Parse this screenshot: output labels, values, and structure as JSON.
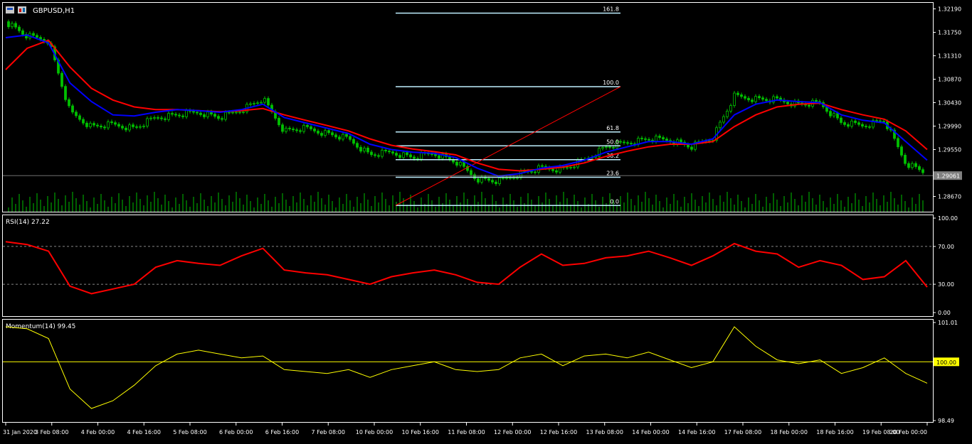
{
  "colors": {
    "background": "#000000",
    "candle": "#00c000",
    "volume": "#00c000",
    "fast_ma": "#0000ff",
    "slow_ma": "#ff0000",
    "fib_line": "#bfefff",
    "trend_line": "#ff0000",
    "rsi": "#ff0000",
    "momentum": "#ffff00",
    "text": "#ffffff",
    "axis": "#ffffff"
  },
  "chart_title": "GBPUSD,H1",
  "current_price_label": "1.29061",
  "chart_data": [
    {
      "type": "line",
      "panel": "price",
      "title": "GBPUSD,H1",
      "ylim": [
        1.2845,
        1.3225
      ],
      "y_ticks": [
        "1.32190",
        "1.31750",
        "1.31310",
        "1.30870",
        "1.30430",
        "1.29990",
        "1.29550",
        "1.29061",
        "1.28670"
      ],
      "x_tick_labels": [
        "31 Jan 2020",
        "3 Feb 08:00",
        "4 Feb 00:00",
        "4 Feb 16:00",
        "5 Feb 08:00",
        "6 Feb 00:00",
        "6 Feb 16:00",
        "7 Feb 08:00",
        "10 Feb 00:00",
        "10 Feb 16:00",
        "11 Feb 08:00",
        "12 Feb 00:00",
        "12 Feb 16:00",
        "13 Feb 08:00",
        "14 Feb 00:00",
        "14 Feb 16:00",
        "17 Feb 08:00",
        "18 Feb 00:00",
        "18 Feb 16:00",
        "19 Feb 08:00",
        "20 Feb 00:00"
      ],
      "x": [
        0,
        8,
        16,
        24,
        32,
        40,
        48,
        56,
        64,
        72,
        80,
        88,
        96,
        104,
        112,
        120,
        128,
        136,
        144,
        152,
        160,
        168,
        176,
        184,
        192,
        200,
        208,
        216,
        224,
        232,
        240,
        248,
        256,
        264,
        272,
        280,
        288,
        296,
        304,
        312,
        320,
        328,
        336,
        344
      ],
      "series": [
        {
          "values": [
            1.3195,
            1.3168,
            1.316,
            1.3025,
            1.2998,
            1.3002,
            1.2995,
            1.3015,
            1.302,
            1.3025,
            1.3015,
            1.303,
            1.305,
            1.299,
            1.2995,
            1.2985,
            1.2975,
            1.2945,
            1.295,
            1.294,
            1.2948,
            1.2932,
            1.29,
            1.2895,
            1.291,
            1.292,
            1.2918,
            1.2935,
            1.296,
            1.2968,
            1.2975,
            1.2973,
            1.296,
            1.2978,
            1.3055,
            1.305,
            1.3048,
            1.304,
            1.3042,
            1.3005,
            1.3,
            1.301,
            1.293,
            1.291
          ]
        },
        {
          "values": [
            1.3165,
            1.317,
            1.3155,
            1.308,
            1.3045,
            1.302,
            1.3018,
            1.3025,
            1.303,
            1.3028,
            1.3025,
            1.303,
            1.304,
            1.3015,
            1.3005,
            1.2995,
            1.2985,
            1.2965,
            1.2955,
            1.295,
            1.2948,
            1.294,
            1.292,
            1.2905,
            1.291,
            1.292,
            1.2925,
            1.2935,
            1.295,
            1.296,
            1.297,
            1.297,
            1.2965,
            1.2975,
            1.302,
            1.304,
            1.3048,
            1.3045,
            1.3043,
            1.302,
            1.301,
            1.3005,
            1.297,
            1.2935
          ]
        },
        {
          "values": [
            1.3105,
            1.3145,
            1.316,
            1.311,
            1.307,
            1.3048,
            1.3035,
            1.303,
            1.303,
            1.3028,
            1.3026,
            1.3028,
            1.3032,
            1.302,
            1.301,
            1.3,
            1.299,
            1.2975,
            1.2963,
            1.2956,
            1.2951,
            1.2945,
            1.293,
            1.2918,
            1.2915,
            1.2918,
            1.2922,
            1.293,
            1.2942,
            1.2952,
            1.296,
            1.2965,
            1.2965,
            1.297,
            1.2998,
            1.302,
            1.3035,
            1.304,
            1.3042,
            1.303,
            1.302,
            1.3012,
            1.299,
            1.2955
          ]
        }
      ],
      "fib_levels": [
        {
          "label": "161.8",
          "value": 1.3211
        },
        {
          "label": "100.0",
          "value": 1.3073
        },
        {
          "label": "61.8",
          "value": 1.2988
        },
        {
          "label": "50.0",
          "value": 1.2962
        },
        {
          "label": "38.2",
          "value": 1.2936
        },
        {
          "label": "23.6",
          "value": 1.2903
        },
        {
          "label": "0.0",
          "value": 1.285
        }
      ],
      "current_price": 1.29061
    },
    {
      "type": "line",
      "panel": "rsi",
      "title": "RSI(14) 27.22",
      "ylim": [
        0,
        100
      ],
      "y_ticks": [
        "100.00",
        "70.00",
        "30.00",
        "0.00"
      ],
      "levels": [
        70,
        30
      ],
      "x": [
        0,
        8,
        16,
        24,
        32,
        40,
        48,
        56,
        64,
        72,
        80,
        88,
        96,
        104,
        112,
        120,
        128,
        136,
        144,
        152,
        160,
        168,
        176,
        184,
        192,
        200,
        208,
        216,
        224,
        232,
        240,
        248,
        256,
        264,
        272,
        280,
        288,
        296,
        304,
        312,
        320,
        328,
        336,
        344
      ],
      "series": [
        {
          "values": [
            75,
            72,
            65,
            28,
            20,
            25,
            30,
            48,
            55,
            52,
            50,
            60,
            68,
            45,
            42,
            40,
            35,
            30,
            38,
            42,
            45,
            40,
            32,
            30,
            48,
            62,
            50,
            52,
            58,
            60,
            65,
            58,
            50,
            60,
            73,
            65,
            62,
            48,
            55,
            50,
            35,
            38,
            55,
            27
          ]
        }
      ]
    },
    {
      "type": "line",
      "panel": "momentum",
      "title": "Momentum(14) 99.45",
      "ylim": [
        98.49,
        101.01
      ],
      "y_ticks": [
        "101.01",
        "100.00",
        "98.49"
      ],
      "levels": [
        100.0
      ],
      "x": [
        0,
        8,
        16,
        24,
        32,
        40,
        48,
        56,
        64,
        72,
        80,
        88,
        96,
        104,
        112,
        120,
        128,
        136,
        144,
        152,
        160,
        168,
        176,
        184,
        192,
        200,
        208,
        216,
        224,
        232,
        240,
        248,
        256,
        264,
        272,
        280,
        288,
        296,
        304,
        312,
        320,
        328,
        336,
        344
      ],
      "series": [
        {
          "values": [
            100.9,
            100.85,
            100.6,
            99.3,
            98.8,
            99.0,
            99.4,
            99.9,
            100.2,
            100.3,
            100.2,
            100.1,
            100.15,
            99.8,
            99.75,
            99.7,
            99.8,
            99.6,
            99.8,
            99.9,
            100.0,
            99.8,
            99.75,
            99.8,
            100.1,
            100.2,
            99.9,
            100.15,
            100.2,
            100.1,
            100.25,
            100.05,
            99.85,
            100.0,
            100.9,
            100.4,
            100.05,
            99.95,
            100.05,
            99.7,
            99.85,
            100.1,
            99.7,
            99.45
          ]
        }
      ]
    }
  ]
}
